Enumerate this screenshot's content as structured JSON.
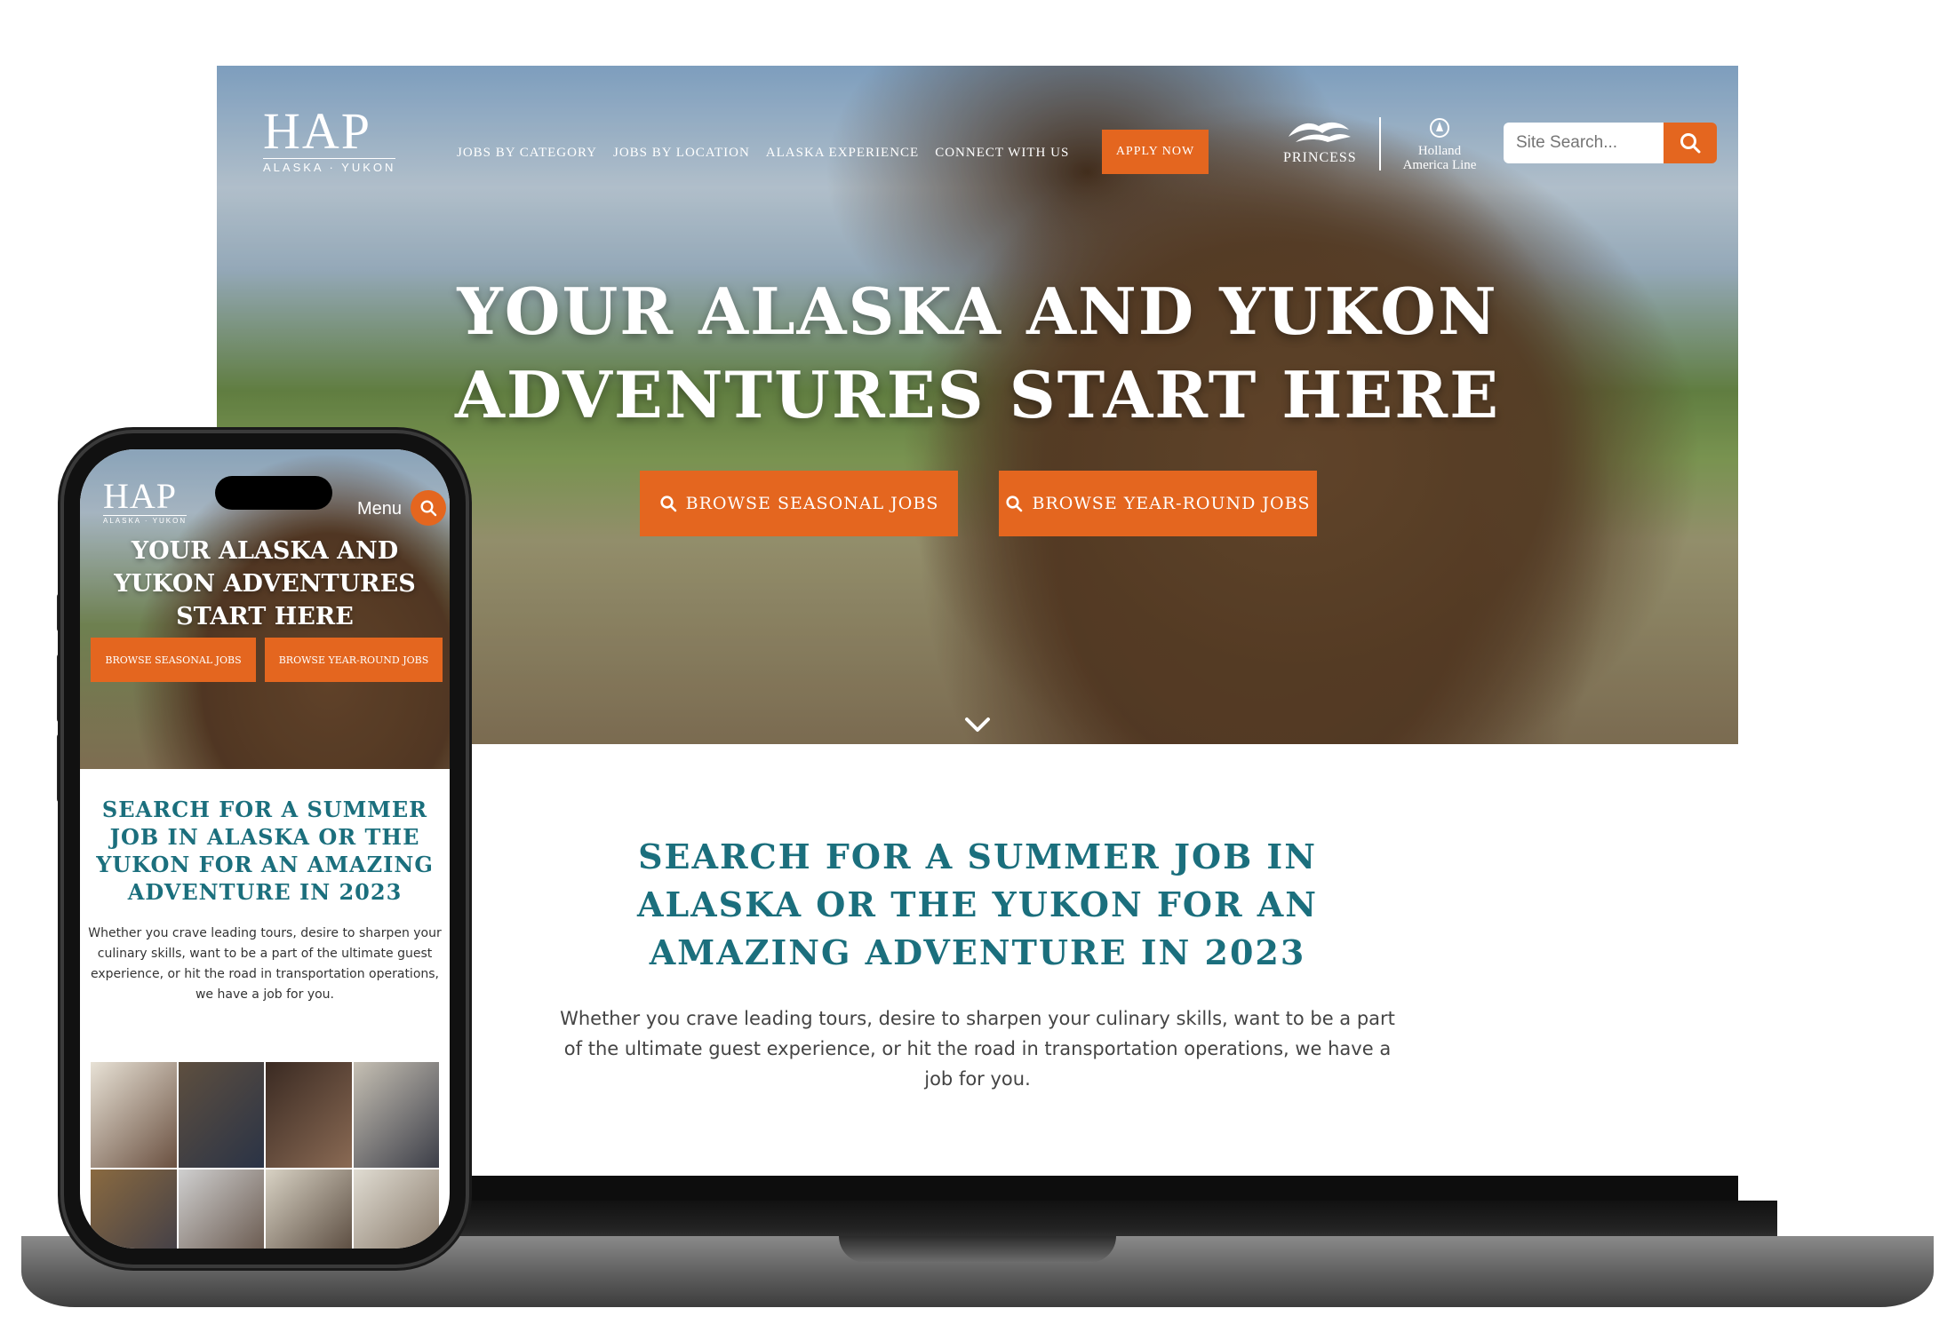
{
  "desktop": {
    "logo": {
      "main": "HAP",
      "sub": "ALASKA · YUKON"
    },
    "nav": [
      {
        "label": "JOBS BY CATEGORY"
      },
      {
        "label": "JOBS BY LOCATION"
      },
      {
        "label": "ALASKA EXPERIENCE"
      },
      {
        "label": "CONNECT WITH US"
      }
    ],
    "apply_label": "APPLY NOW",
    "brands": {
      "princess": "PRINCESS",
      "holland_line1": "Holland",
      "holland_line2": "America Line"
    },
    "search": {
      "placeholder": "Site Search..."
    },
    "hero": {
      "title_line1": "YOUR ALASKA AND YUKON",
      "title_line2": "ADVENTURES START HERE",
      "btn_seasonal": "BROWSE SEASONAL JOBS",
      "btn_yearround": "BROWSE YEAR-ROUND JOBS"
    },
    "intro": {
      "title": "SEARCH FOR A SUMMER JOB IN ALASKA OR THE YUKON FOR AN AMAZING ADVENTURE IN 2023",
      "text": "Whether you crave leading tours, desire to sharpen your culinary skills, want to be a part of the ultimate guest experience, or hit the road in transportation operations, we have a job for you."
    }
  },
  "mobile": {
    "logo": {
      "main": "HAP",
      "sub": "ALASKA · YUKON"
    },
    "menu_label": "Menu",
    "hero": {
      "title": "YOUR ALASKA AND YUKON ADVENTURES START HERE",
      "btn_seasonal": "BROWSE SEASONAL JOBS",
      "btn_yearround": "BROWSE YEAR-ROUND JOBS"
    },
    "intro": {
      "title": "SEARCH FOR A SUMMER JOB IN ALASKA OR THE YUKON FOR AN AMAZING ADVENTURE IN 2023",
      "text": "Whether you crave leading tours, desire to sharpen your culinary skills, want to be a part of the ultimate guest experience, or hit the road in transportation operations, we have a job for you."
    }
  },
  "colors": {
    "accent": "#e4661f",
    "teal": "#1b6f7d",
    "body_text": "#444444"
  },
  "icons": {
    "search": "search-icon",
    "chevron": "chevron-down-icon",
    "wave": "princess-wave-icon"
  }
}
